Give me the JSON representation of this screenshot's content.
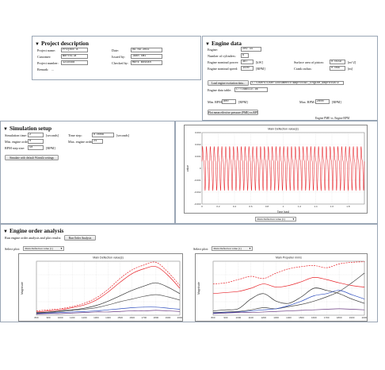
{
  "project": {
    "title": "Project description",
    "name_label": "Project name:",
    "name_value": "Project A",
    "customer_label": "Customer:",
    "customer_value": "Wärtsilä",
    "number_label": "Project number:",
    "number_value": "1234568",
    "remark_label": "Remark:",
    "remark_value": "...",
    "date_label": "Date:",
    "date_value": "09.09.2011",
    "issued_label": "Issued by:",
    "issued_value": "Jaan Smi",
    "checked_label": "Checked by:",
    "checked_value": "Mark Boscan"
  },
  "engine": {
    "title": "Engine data",
    "engine_label": "Engine:",
    "engine_value": "20V 34",
    "cyl_label": "Number of cylinders:",
    "cyl_value": "6",
    "power_label": "Engine nominal power:",
    "power_value": "387",
    "power_unit": "[kW]",
    "speed_label": "Engine nominal speed:",
    "speed_value": "1500",
    "speed_unit": "[RPM]",
    "piston_label": "Surface area of piston:",
    "piston_value": "0.0159",
    "piston_unit": "[m^2]",
    "crank_label": "Crank radius:",
    "crank_value": "0.066",
    "crank_unit": "[m]",
    "load_button": "Load engine excitation data...",
    "path_value": "C:\\Users\\user\\Documents\\WaprotoA\\_Engine_WaprotoA\\E",
    "table_label": "Engine data table:",
    "table_value": "C:\\TABELLE.DE",
    "min_rpm_label": "Min. RPM:",
    "min_rpm_value": "800",
    "min_rpm_unit": "[RPM]",
    "max_rpm_label": "Max. RPM:",
    "max_rpm_value": "2000",
    "max_rpm_unit": "[RPM]",
    "plot_button": "Plot mean effective pressure (PME) vs RPM",
    "plot_title": "Engine PME vs. Engine RPM"
  },
  "simulation": {
    "title": "Simulation setup",
    "time_label": "Simulation time:",
    "time_value": "2",
    "time_unit": "[seconds]",
    "min_order_label": "Min. engine order:",
    "min_order_value": "0",
    "rpm_step_label": "RPM step size:",
    "rpm_step_value": "50",
    "rpm_step_unit": "[RPM]",
    "timestep_label": "Time step:",
    "timestep_value": "0.0008",
    "timestep_unit": "[seconds]",
    "max_order_label": "Max. engine order:",
    "max_order_value": "24",
    "run_button": "Simulate with default Wärtsilä settings",
    "select_value": "Main Deflection value (1)"
  },
  "order": {
    "title": "Engine order analysis",
    "instruction": "Run engine order analysis and plot results:",
    "run_button": "Run Order Analysis",
    "left_select_label": "Select plot:",
    "left_select_value": "Main Deflection value (1)",
    "right_select_label": "Select plot:",
    "right_select_value": "Main Deflection value (1)"
  },
  "chart_data": [
    {
      "type": "line",
      "title": "Main Deflection value(s)",
      "xlabel": "Time [sec]",
      "ylabel": "value",
      "xlim": [
        0,
        2
      ],
      "ylim": [
        -0.003,
        0.003
      ],
      "xticks": [
        "0",
        "0.2",
        "0.4",
        "0.6",
        "0.8",
        "1",
        "1.2",
        "1.4",
        "1.6",
        "1.8"
      ],
      "yticks": [
        "0.003",
        "0.002",
        "0.001",
        "0",
        "-0.001",
        "-0.002",
        "-0.003"
      ],
      "grid": true,
      "series": [
        {
          "color": "#e8242a",
          "cycles": 42,
          "amplitude": 0.0022,
          "offset": 0.0002
        }
      ]
    },
    {
      "type": "line",
      "title": "Main Deflection value(s)",
      "xlabel": "",
      "ylabel": "Magnitude",
      "x": [
        800,
        900,
        1000,
        1100,
        1200,
        1300,
        1400,
        1500,
        1600,
        1700,
        1800,
        1900,
        2000
      ],
      "xticks": [
        "800",
        "900",
        "1000",
        "1100",
        "1200",
        "1300",
        "1400",
        "1500",
        "1600",
        "1700",
        "1800",
        "1900",
        "2000"
      ],
      "ylim": [
        0,
        1
      ],
      "grid": true,
      "series": [
        {
          "color": "#e8242a",
          "dash": true,
          "values": [
            0.08,
            0.1,
            0.12,
            0.16,
            0.22,
            0.32,
            0.48,
            0.68,
            0.84,
            0.93,
            0.98,
            0.8,
            0.55
          ]
        },
        {
          "color": "#e8242a",
          "dash": false,
          "values": [
            0.06,
            0.08,
            0.1,
            0.14,
            0.19,
            0.28,
            0.43,
            0.61,
            0.77,
            0.86,
            0.9,
            0.74,
            0.5
          ]
        },
        {
          "color": "#333333",
          "dash": false,
          "values": [
            0.05,
            0.06,
            0.08,
            0.1,
            0.13,
            0.18,
            0.26,
            0.36,
            0.46,
            0.54,
            0.6,
            0.52,
            0.4
          ]
        },
        {
          "color": "#555555",
          "dash": false,
          "values": [
            0.04,
            0.05,
            0.07,
            0.09,
            0.11,
            0.14,
            0.19,
            0.25,
            0.3,
            0.35,
            0.38,
            0.34,
            0.28
          ]
        },
        {
          "color": "#3050c0",
          "dash": false,
          "values": [
            0.03,
            0.04,
            0.05,
            0.06,
            0.07,
            0.08,
            0.1,
            0.12,
            0.14,
            0.15,
            0.15,
            0.13,
            0.11
          ]
        },
        {
          "color": "#6a3a80",
          "dash": false,
          "values": [
            0.02,
            0.03,
            0.03,
            0.04,
            0.05,
            0.06,
            0.06,
            0.07,
            0.08,
            0.08,
            0.09,
            0.08,
            0.07
          ]
        }
      ]
    },
    {
      "type": "line",
      "title": "Main Propeller mm/s",
      "xlabel": "",
      "ylabel": "Magnitude",
      "x": [
        800,
        900,
        1000,
        1100,
        1200,
        1300,
        1400,
        1500,
        1600,
        1700,
        1800,
        1900,
        2000
      ],
      "xticks": [
        "800",
        "900",
        "1000",
        "1100",
        "1200",
        "1300",
        "1400",
        "1500",
        "1600",
        "1700",
        "1800",
        "1900",
        "2000"
      ],
      "ylim": [
        0,
        1
      ],
      "grid": true,
      "series": [
        {
          "color": "#e8242a",
          "dash": true,
          "values": [
            0.58,
            0.6,
            0.66,
            0.72,
            0.68,
            0.78,
            0.86,
            0.9,
            0.92,
            0.88,
            0.95,
            0.98,
            0.99
          ]
        },
        {
          "color": "#e8242a",
          "dash": false,
          "values": [
            0.4,
            0.42,
            0.44,
            0.5,
            0.58,
            0.52,
            0.55,
            0.62,
            0.7,
            0.66,
            0.6,
            0.55,
            0.52
          ]
        },
        {
          "color": "#333333",
          "dash": false,
          "values": [
            0.08,
            0.1,
            0.12,
            0.3,
            0.4,
            0.26,
            0.22,
            0.34,
            0.5,
            0.46,
            0.4,
            0.3,
            0.22
          ]
        },
        {
          "color": "#444444",
          "dash": false,
          "values": [
            0.05,
            0.06,
            0.07,
            0.1,
            0.14,
            0.12,
            0.16,
            0.2,
            0.26,
            0.34,
            0.44,
            0.6,
            0.78
          ]
        },
        {
          "color": "#3050c0",
          "dash": false,
          "values": [
            0.04,
            0.05,
            0.06,
            0.08,
            0.1,
            0.12,
            0.18,
            0.26,
            0.36,
            0.4,
            0.46,
            0.38,
            0.3
          ]
        },
        {
          "color": "#6a3a80",
          "dash": false,
          "values": [
            0.03,
            0.04,
            0.05,
            0.05,
            0.06,
            0.07,
            0.08,
            0.09,
            0.1,
            0.11,
            0.12,
            0.11,
            0.1
          ]
        }
      ]
    }
  ]
}
